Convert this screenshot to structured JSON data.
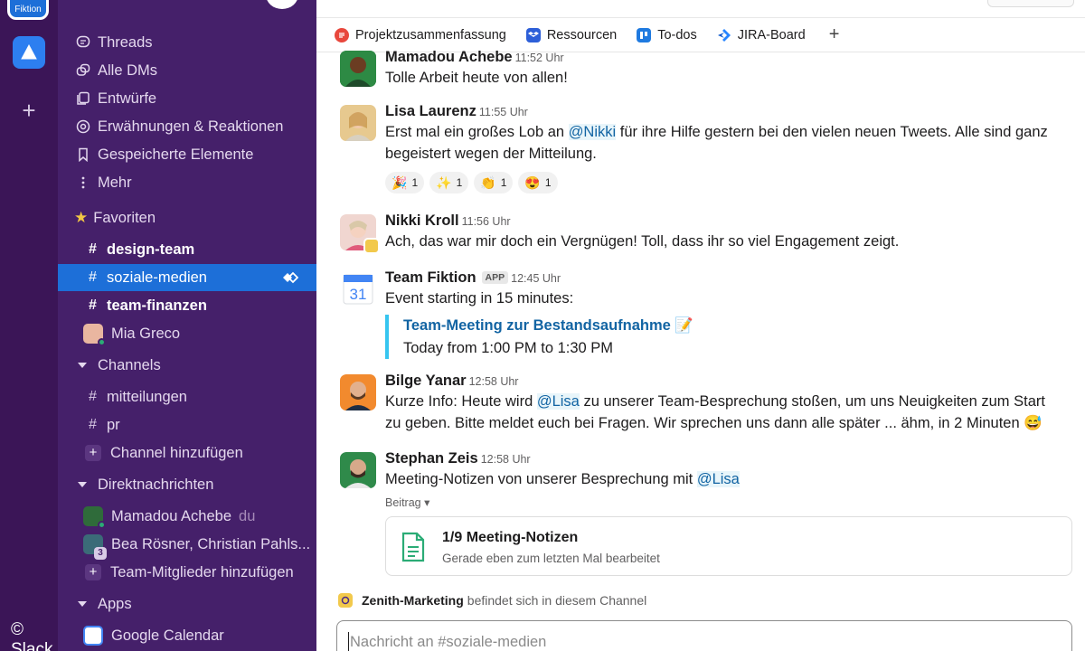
{
  "workspace": {
    "tile_label": "Fiktion"
  },
  "rail": {
    "add_label": "+"
  },
  "watermark": "© Slack",
  "sidebar": {
    "nav": [
      {
        "label": "Threads",
        "icon": "threads-icon"
      },
      {
        "label": "Alle DMs",
        "icon": "dms-icon"
      },
      {
        "label": "Entwürfe",
        "icon": "drafts-icon"
      },
      {
        "label": "Erwähnungen & Reaktionen",
        "icon": "mentions-icon"
      },
      {
        "label": "Gespeicherte Elemente",
        "icon": "bookmark-icon"
      },
      {
        "label": "Mehr",
        "icon": "more-icon"
      }
    ],
    "favorites_label": "Favoriten",
    "favorites": [
      {
        "label": "design-team",
        "hash": "#"
      },
      {
        "label": "soziale-medien",
        "hash": "#"
      },
      {
        "label": "team-finanzen",
        "hash": "#"
      },
      {
        "label": "Mia Greco"
      }
    ],
    "channels_label": "Channels",
    "channels": [
      {
        "label": "mitteilungen",
        "hash": "#"
      },
      {
        "label": "pr",
        "hash": "#"
      }
    ],
    "add_channel": "Channel hinzufügen",
    "dms_label": "Direktnachrichten",
    "dms": [
      {
        "label": "Mamadou Achebe",
        "suffix": "du"
      },
      {
        "label": "Bea Rösner, Christian Pahls...",
        "count": "3"
      }
    ],
    "add_member": "Team-Mitglieder hinzufügen",
    "apps_label": "Apps",
    "apps": [
      {
        "label": "Google Calendar"
      }
    ],
    "plus": "+"
  },
  "bookmarks": [
    {
      "label": "Projektzusammenfassung",
      "color": "#e8473c"
    },
    {
      "label": "Ressourcen",
      "color": "#2d5fd8"
    },
    {
      "label": "To-dos",
      "color": "#1f7ae0"
    },
    {
      "label": "JIRA-Board",
      "color": "#2684ff"
    }
  ],
  "bookmark_add": "+",
  "messages": [
    {
      "name": "Mamadou Achebe",
      "time": "11:52 Uhr",
      "text": "Tolle Arbeit heute von allen!"
    },
    {
      "name": "Lisa Laurenz",
      "time": "11:55 Uhr",
      "text_before": "Erst mal ein großes Lob an ",
      "mention": "@Nikki",
      "text_after": " für ihre Hilfe gestern bei den vielen neuen Tweets. Alle sind ganz begeistert wegen der Mitteilung.",
      "reactions": [
        {
          "emoji": "🎉",
          "count": "1"
        },
        {
          "emoji": "✨",
          "count": "1"
        },
        {
          "emoji": "👏",
          "count": "1"
        },
        {
          "emoji": "😍",
          "count": "1"
        }
      ]
    },
    {
      "name": "Nikki Kroll",
      "time": "11:56 Uhr",
      "text": "Ach, das war mir doch ein Vergnügen! Toll, dass ihr so viel Engagement zeigt."
    },
    {
      "name": "Team Fiktion",
      "badge": "APP",
      "time": "12:45 Uhr",
      "text": "Event starting in 15 minutes:",
      "event_title": "Team-Meeting zur Bestandsaufnahme 📝",
      "event_time": "Today from 1:00 PM to 1:30 PM",
      "calendar_day": "31"
    },
    {
      "name": "Bilge Yanar",
      "time": "12:58 Uhr",
      "text_before": "Kurze Info: Heute wird ",
      "mention": "@Lisa",
      "text_after": " zu unserer Team-Besprechung stoßen, um uns Neuigkeiten zum Start zu geben. Bitte meldet euch bei Fragen. Wir sprechen uns dann alle später ... ähm, in 2 Minuten 😅"
    },
    {
      "name": "Stephan Zeis",
      "time": "12:58 Uhr",
      "text_before": "Meeting-Notizen von unserer Besprechung mit ",
      "mention": "@Lisa",
      "beitrag": "Beitrag ▾",
      "post_title": "1/9 Meeting-Notizen",
      "post_subtitle": "Gerade eben zum letzten Mal bearbeitet"
    }
  ],
  "zenith": {
    "name": "Zenith-Marketing",
    "text": "befindet sich in diesem Channel"
  },
  "composer": {
    "placeholder": "Nachricht an #soziale-medien"
  },
  "colors": {
    "sidebar": "#45206a",
    "active": "#1d6fd8",
    "mention": "#1264a3"
  }
}
